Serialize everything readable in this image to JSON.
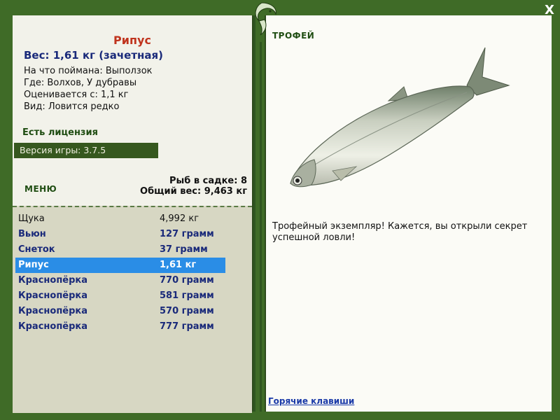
{
  "window": {
    "close_label": "X"
  },
  "fish": {
    "name": "Рипус",
    "weight_line": "Вес: 1,61 кг (зачетная)",
    "caught_with": "На что поймана: Выползок",
    "location": "Где: Волхов, У дубравы",
    "valued_from": "Оценивается с: 1,1 кг",
    "rarity": "Вид: Ловится редко"
  },
  "license": "Есть лицензия",
  "version": "Версия игры: 3.7.5",
  "menu_label": "МЕНЮ",
  "stats": {
    "count_line": "Рыб в садке: 8",
    "total_line": "Общий вес: 9,463 кг"
  },
  "catch_list": [
    {
      "name": "Щука",
      "weight": "4,992 кг",
      "style": "normal"
    },
    {
      "name": "Вьюн",
      "weight": "127 грамм",
      "style": "bold"
    },
    {
      "name": "Снеток",
      "weight": "37 грамм",
      "style": "bold"
    },
    {
      "name": "Рипус",
      "weight": "1,61 кг",
      "style": "sel"
    },
    {
      "name": "Краснопёрка",
      "weight": "770 грамм",
      "style": "bold"
    },
    {
      "name": "Краснопёрка",
      "weight": "581 грамм",
      "style": "bold"
    },
    {
      "name": "Краснопёрка",
      "weight": "570 грамм",
      "style": "bold"
    },
    {
      "name": "Краснопёрка",
      "weight": "777 грамм",
      "style": "bold"
    }
  ],
  "trophy_label": "ТРОФЕЙ",
  "trophy_text": "Трофейный экземпляр! Кажется, вы открыли секрет успешной ловли!",
  "hotkeys_label": "Горячие клавиши",
  "icons": {
    "close": "close-icon",
    "emblem": "fish-emblem-icon",
    "fish_picture": "whitefish-image"
  },
  "colors": {
    "frame": "#3f6b27",
    "title": "#c0341e",
    "selected": "#2a8de6",
    "accent_text": "#1a2a7a"
  }
}
